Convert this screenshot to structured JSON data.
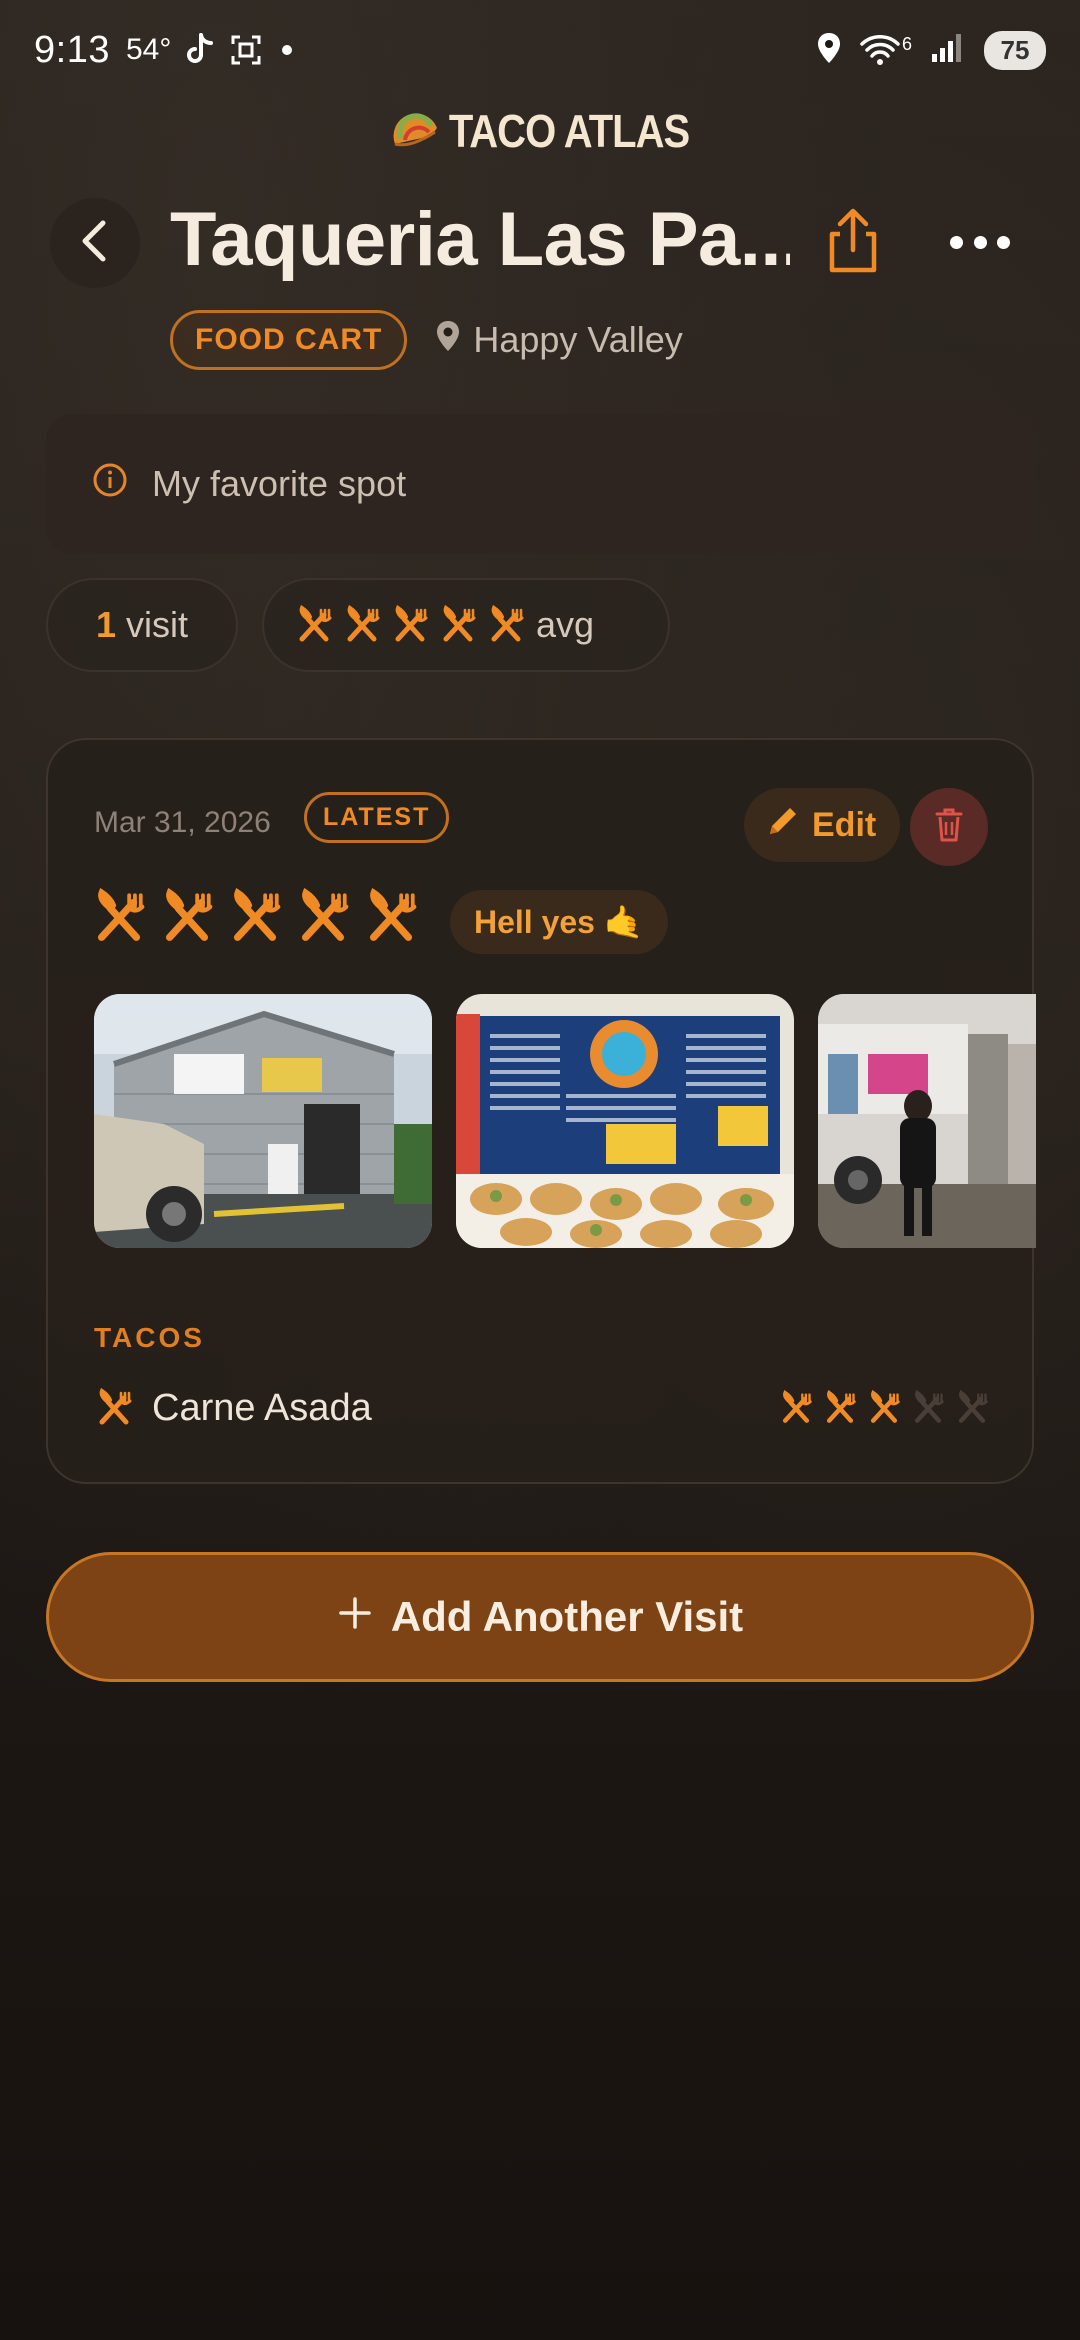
{
  "status_bar": {
    "time": "9:13",
    "temperature": "54°",
    "network": "6",
    "battery": "75"
  },
  "app": {
    "logo_text": "TACO ATLAS"
  },
  "header": {
    "title": "Taqueria Las Pa...",
    "type_tag": "FOOD CART",
    "location": "Happy Valley"
  },
  "note": {
    "text": "My favorite spot"
  },
  "stats": {
    "visit_count": "1",
    "visit_label": "visit",
    "avg_label": "avg",
    "avg_rating": 5
  },
  "visit": {
    "date": "Mar 31, 2026",
    "badge": "LATEST",
    "edit_label": "Edit",
    "rating": 5,
    "mood": "Hell yes 🤙",
    "photos": [
      "storefront",
      "menu board",
      "food cart"
    ],
    "section_title": "TACOS",
    "tacos": [
      {
        "name": "Carne Asada",
        "rating": 3
      }
    ]
  },
  "add_visit_label": "Add Another Visit",
  "colors": {
    "accent": "#F08A24",
    "background": "#241E19",
    "button": "#7D4314"
  },
  "icons": [
    "back-icon",
    "share-icon",
    "more-icon",
    "pin-icon",
    "info-icon",
    "pencil-icon",
    "trash-icon",
    "utensils-icon",
    "plus-icon"
  ]
}
